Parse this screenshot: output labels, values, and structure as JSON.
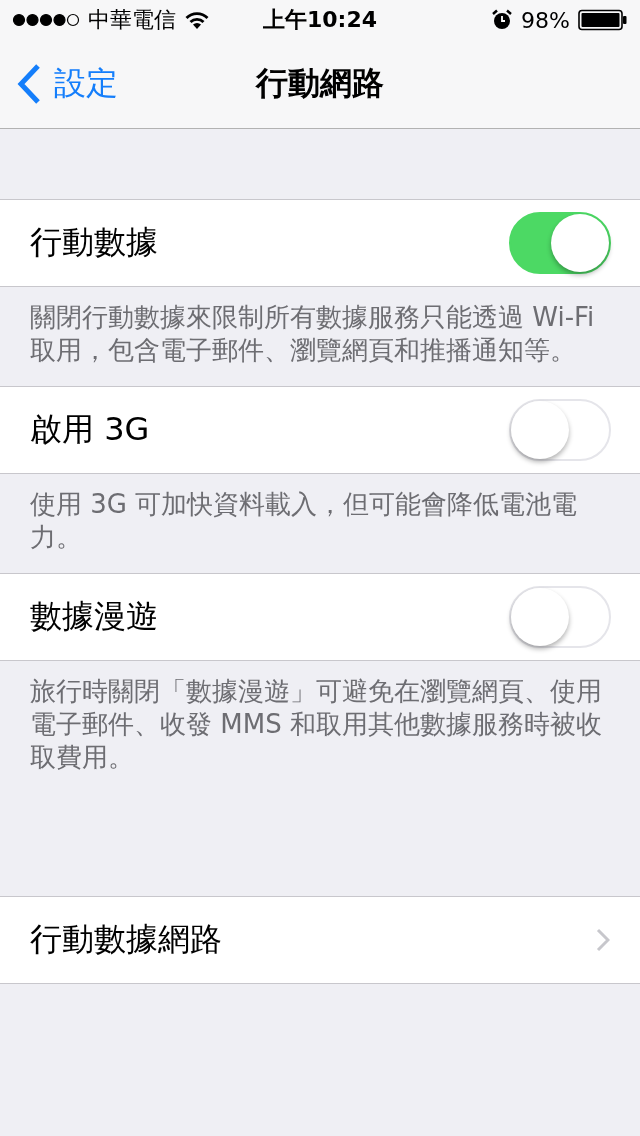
{
  "status_bar": {
    "carrier": "中華電信",
    "time": "上午10:24",
    "battery": "98%"
  },
  "nav_bar": {
    "back": "設定",
    "title": "行動網路"
  },
  "sections": [
    {
      "kind": "toggle",
      "label": "行動數據",
      "on": true,
      "footer": "關閉行動數據來限制所有數據服務只能透過 Wi-Fi 取用，包含電子郵件、瀏覽網頁和推播通知等。"
    },
    {
      "kind": "toggle",
      "label": "啟用 3G",
      "on": false,
      "footer": "使用 3G 可加快資料載入，但可能會降低電池電力。"
    },
    {
      "kind": "toggle",
      "label": "數據漫遊",
      "on": false,
      "footer": "旅行時關閉「數據漫遊」可避免在瀏覽網頁、使用電子郵件、收發 MMS 和取用其他數據服務時被收取費用。"
    },
    {
      "kind": "link",
      "label": "行動數據網路"
    }
  ]
}
